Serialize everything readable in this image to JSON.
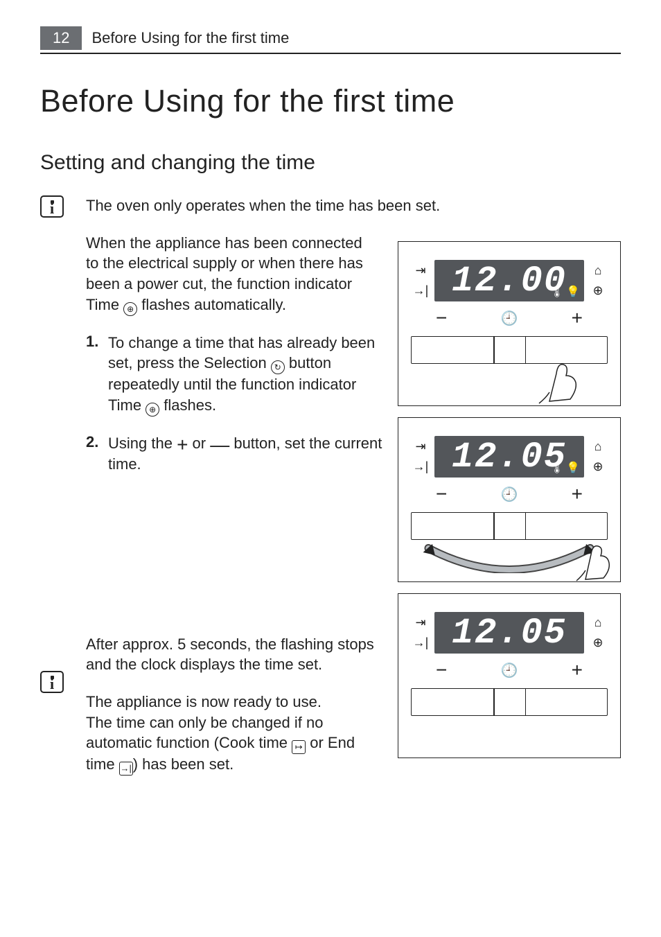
{
  "header": {
    "page_number": "12",
    "section": "Before Using for the first time"
  },
  "title": "Before Using for the first time",
  "subtitle": "Setting and changing the time",
  "intro_note": "The oven only operates when the time has been set.",
  "para1": {
    "t1": "When the appliance has been connected to the electrical supply or when there has been a power cut, the function indicator Time ",
    "t2": " flashes automatically."
  },
  "step1": {
    "num": "1.",
    "t1": "To change a time that has already been set, press the Selection ",
    "t2": " button repeatedly until the function indicator Time ",
    "t3": " flashes."
  },
  "step2": {
    "num": "2.",
    "t1": "Using the ",
    "plus": "+",
    "t2": " or ",
    "minus": "—",
    "t3": " button, set the current time."
  },
  "para2": "After approx. 5 seconds, the flashing stops and the clock displays the time set.",
  "para3": "The appliance is now ready to use.",
  "note2": {
    "t1": "The time can only be changed if no automatic function (Cook time ",
    "t2": " or End time ",
    "t3": ") has been set."
  },
  "figs": {
    "f1": {
      "digits": "12.00"
    },
    "f2": {
      "digits": "12.05"
    },
    "f3": {
      "digits": "12.05"
    }
  },
  "glyphs": {
    "time_clock": "⊕",
    "selection": "↻",
    "cook_time": "↦",
    "end_time": "→|",
    "start_arrow": "⇥",
    "end_arrow": "→|",
    "bell": "⌂",
    "clock_small": "⊕",
    "plus": "+",
    "minus": "−",
    "sel_btn": "🕘",
    "temp": "🌡",
    "light": "💡"
  }
}
